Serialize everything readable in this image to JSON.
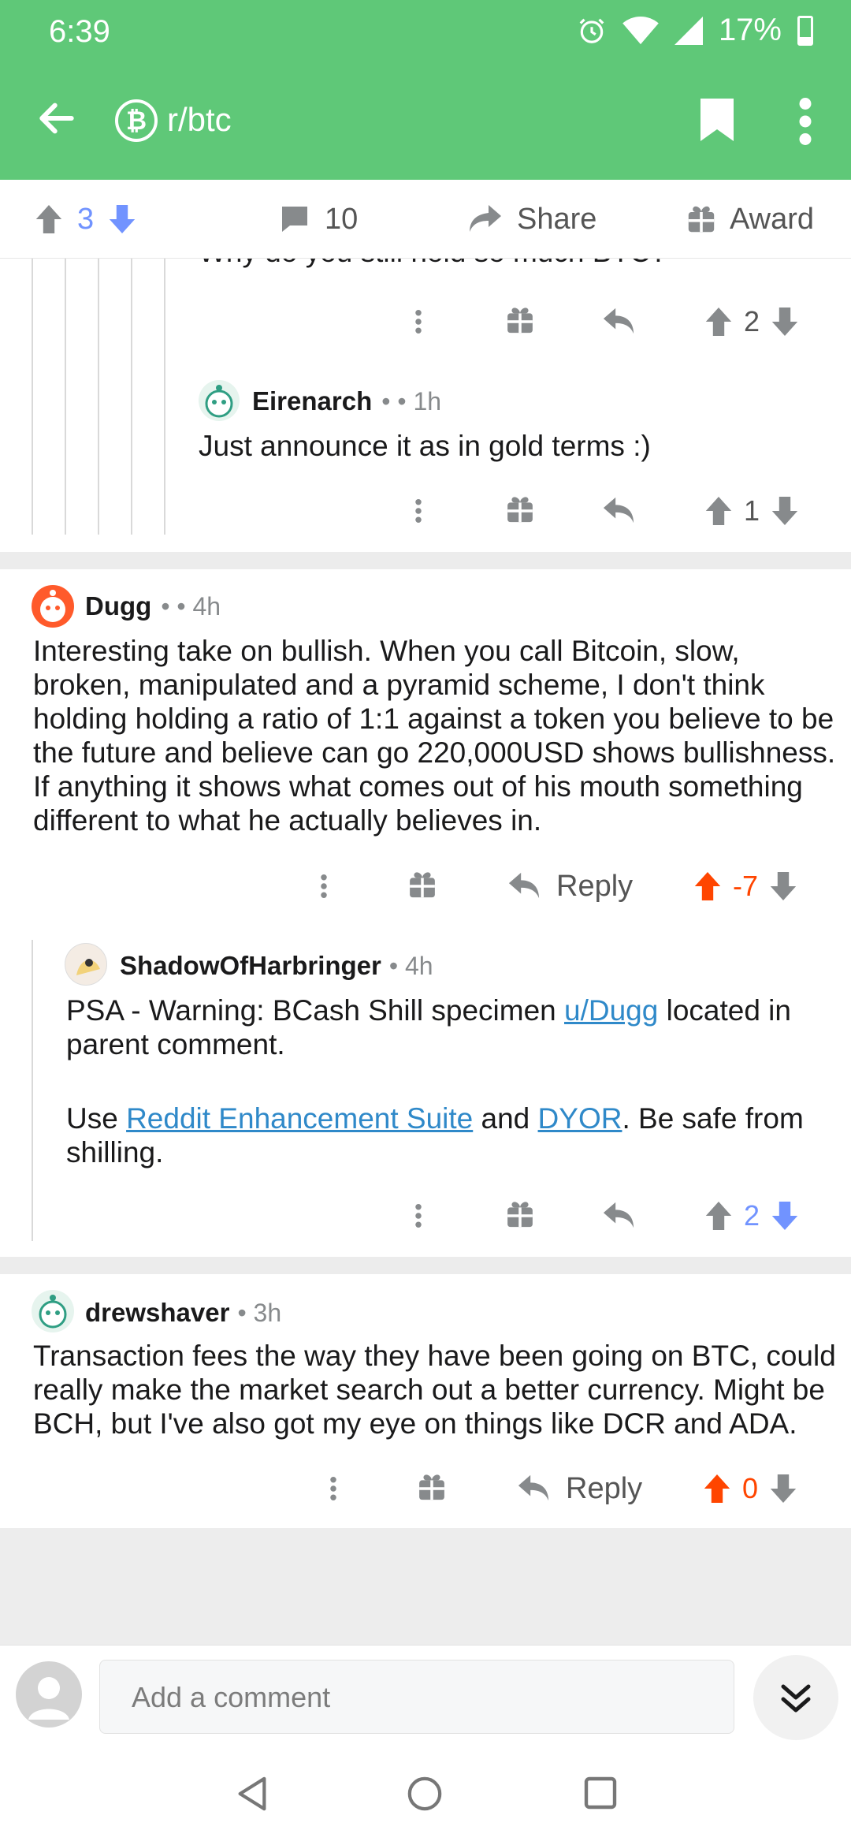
{
  "status_bar": {
    "time": "6:39",
    "battery": "17%"
  },
  "app_bar": {
    "subreddit": "r/btc",
    "sub_icon_glyph": "₿"
  },
  "action_bar": {
    "score": "3",
    "comments": "10",
    "share": "Share",
    "award": "Award"
  },
  "comments": [
    {
      "cut_text": "Why do you still hold so much BTC?",
      "score": "2"
    },
    {
      "author": "Eirenarch",
      "meta": "• • 1h",
      "body": "Just announce it as in gold terms :)",
      "score": "1"
    },
    {
      "author": "Dugg",
      "meta": "• • 4h",
      "body_lines": [
        "Interesting take on bullish. When you call Bitcoin, slow,",
        "broken, manipulated and a pyramid scheme, I don't think",
        "holding holding a ratio of 1:1 against a token you believe to be",
        "the future and believe can go 220,000USD shows bullishness.",
        "If anything it shows what comes out of his mouth something",
        "different to what he actually believes in."
      ],
      "reply": "Reply",
      "score": "-7"
    },
    {
      "author": "ShadowOfHarbringer",
      "meta": "• 4h",
      "p1_a": "PSA - Warning: BCash Shill specimen ",
      "p1_link": "u/Dugg",
      "p1_b": " located in",
      "p1_c": "parent comment.",
      "p2_a": "Use ",
      "p2_link1": "Reddit Enhancement Suite",
      "p2_b": " and ",
      "p2_link2": "DYOR",
      "p2_c": ". Be safe from",
      "p2_d": "shilling.",
      "score": "2"
    },
    {
      "author": "drewshaver",
      "meta": "• 3h",
      "body_lines": [
        "Transaction fees the way they have been going on BTC, could",
        "really make the market search out a better currency. Might be",
        "BCH, but I've also got my eye on things like DCR and ADA."
      ],
      "reply": "Reply",
      "score": "0"
    }
  ],
  "composer": {
    "placeholder": "Add a comment"
  },
  "colors": {
    "header_green": "#5fc878",
    "upvote_orange": "#ff4500",
    "downvote_blue": "#7193ff",
    "link_blue": "#2f89c9"
  },
  "icons": [
    "back-arrow-icon",
    "bitcoin-icon",
    "bookmark-icon",
    "more-vert-icon",
    "upvote-icon",
    "downvote-icon",
    "comment-icon",
    "share-icon",
    "gift-icon",
    "reply-icon",
    "double-chevron-down-icon",
    "nav-back-icon",
    "nav-home-icon",
    "nav-recents-icon"
  ]
}
